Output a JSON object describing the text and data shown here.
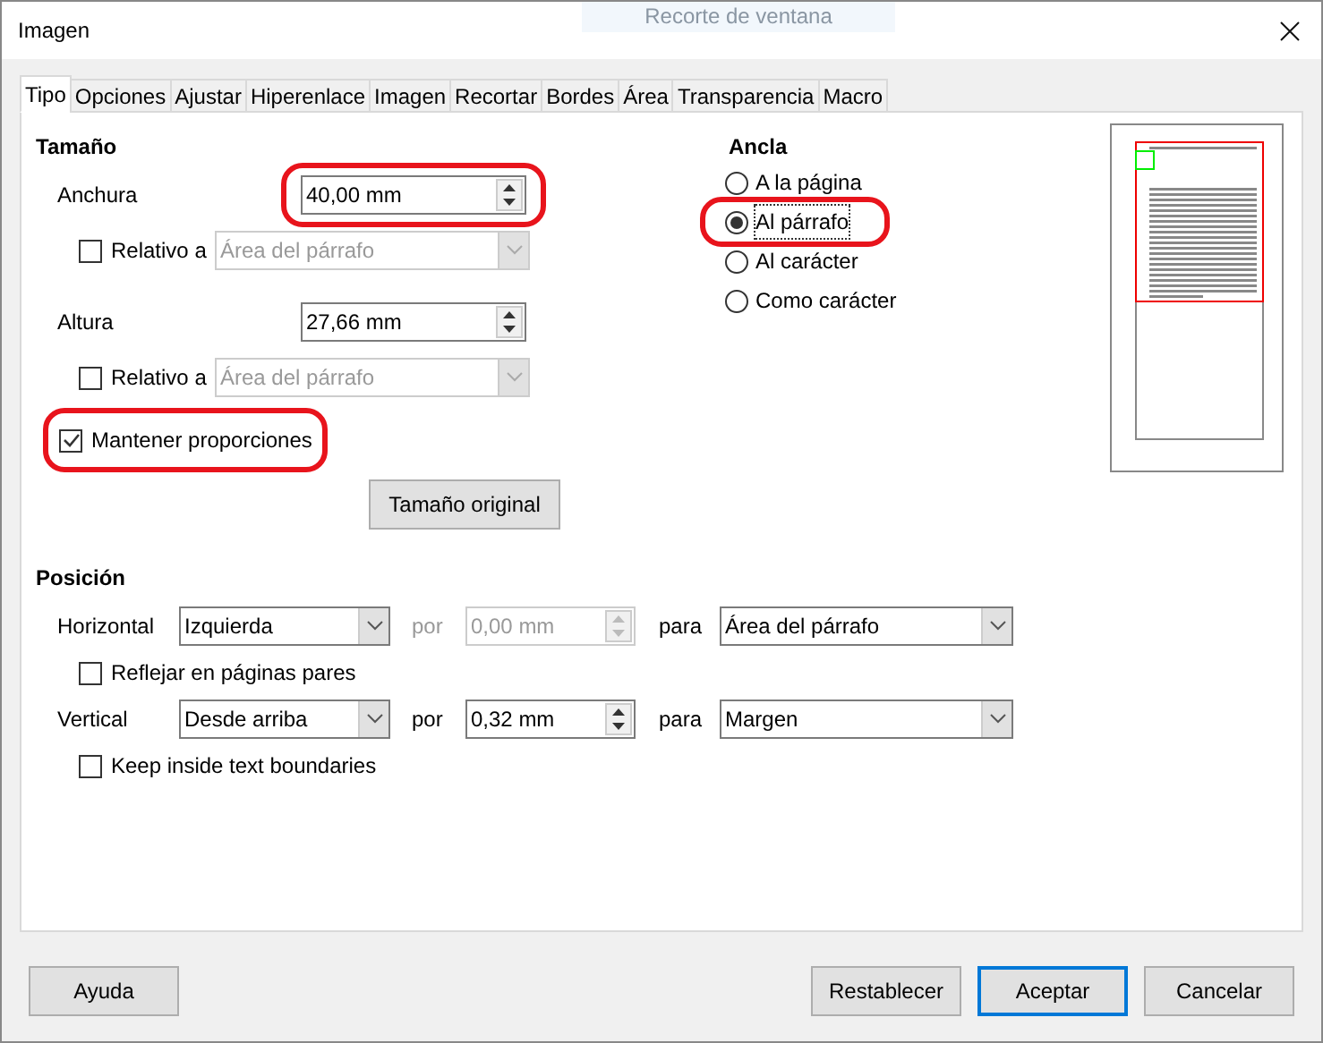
{
  "window": {
    "title": "Imagen",
    "overlay_label": "Recorte de ventana"
  },
  "tabs": [
    {
      "label": "Tipo",
      "selected": true
    },
    {
      "label": "Opciones",
      "selected": false
    },
    {
      "label": "Ajustar",
      "selected": false
    },
    {
      "label": "Hiperenlace",
      "selected": false
    },
    {
      "label": "Imagen",
      "selected": false
    },
    {
      "label": "Recortar",
      "selected": false
    },
    {
      "label": "Bordes",
      "selected": false
    },
    {
      "label": "Área",
      "selected": false
    },
    {
      "label": "Transparencia",
      "selected": false
    },
    {
      "label": "Macro",
      "selected": false
    }
  ],
  "size": {
    "heading": "Tamaño",
    "width": {
      "label": "Anchura",
      "value": "40,00 mm",
      "highlighted": true
    },
    "width_relative": {
      "label": "Relativo a",
      "checked": false,
      "value": "Área del párrafo",
      "disabled": true
    },
    "height": {
      "label": "Altura",
      "value": "27,66 mm",
      "highlighted": false
    },
    "height_relative": {
      "label": "Relativo a",
      "checked": false,
      "value": "Área del párrafo",
      "disabled": true
    },
    "keep_ratio": {
      "label": "Mantener proporciones",
      "checked": true,
      "highlighted": true
    },
    "original_size_button": "Tamaño original"
  },
  "anchor": {
    "heading": "Ancla",
    "options": [
      {
        "label": "A la página",
        "selected": false,
        "highlighted": false
      },
      {
        "label": "Al párrafo",
        "selected": true,
        "highlighted": true
      },
      {
        "label": "Al carácter",
        "selected": false,
        "highlighted": false
      },
      {
        "label": "Como carácter",
        "selected": false,
        "highlighted": false
      }
    ]
  },
  "position": {
    "heading": "Posición",
    "horizontal": {
      "label": "Horizontal",
      "value": "Izquierda",
      "by_label": "por",
      "by_value": "0,00 mm",
      "by_disabled": true,
      "to_label": "para",
      "to_value": "Área del párrafo"
    },
    "mirror": {
      "label": "Reflejar en páginas pares",
      "checked": false
    },
    "vertical": {
      "label": "Vertical",
      "value": "Desde arriba",
      "by_label": "por",
      "by_value": "0,32 mm",
      "by_disabled": false,
      "to_label": "para",
      "to_value": "Margen"
    },
    "keep_inside": {
      "label": "Keep inside text boundaries",
      "checked": false
    }
  },
  "buttons": [
    {
      "label": "Ayuda",
      "default": false
    },
    {
      "label": "Restablecer",
      "default": false
    },
    {
      "label": "Aceptar",
      "default": true
    },
    {
      "label": "Cancelar",
      "default": false
    }
  ]
}
